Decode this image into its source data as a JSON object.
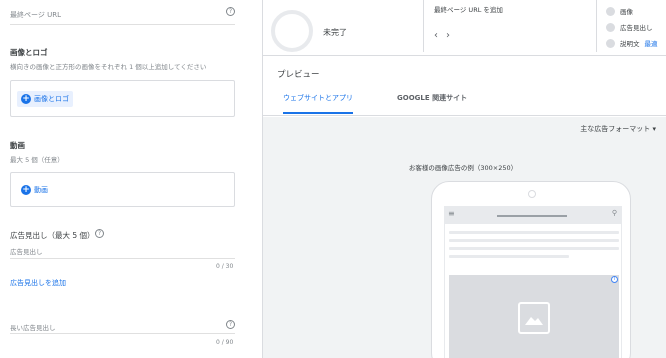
{
  "form": {
    "final_url_placeholder": "最終ページ URL",
    "images": {
      "label": "画像とロゴ",
      "sub": "横向きの画像と正方形の画像をそれぞれ 1 個以上追加してください",
      "button": "画像とロゴ"
    },
    "videos": {
      "label": "動画",
      "sub": "最大 5 個（任意）",
      "button": "動画"
    },
    "headlines": {
      "label": "広告見出し（最大 5 個）",
      "placeholder": "広告見出し",
      "counter": "0 / 30",
      "add_link": "広告見出しを追加"
    },
    "long_headline": {
      "placeholder": "長い広告見出し",
      "counter": "0 / 90"
    }
  },
  "status": {
    "progress_label": "未完了",
    "add_url_text": "最終ページ URL を追加",
    "checklist": [
      {
        "label": "画像"
      },
      {
        "label": "広告見出し"
      },
      {
        "label": "説明文",
        "extra": "最適"
      }
    ]
  },
  "preview": {
    "title": "プレビュー",
    "tabs": [
      "ウェブサイトとアプリ",
      "GOOGLE 関連サイト"
    ],
    "format_dropdown": "主な広告フォーマット",
    "caption": "お客様の画像広告の例（300×250）"
  },
  "icons": {
    "help": "help-circle-icon",
    "add": "plus-circle-icon",
    "image": "image-placeholder-icon",
    "menu": "hamburger-menu-icon",
    "search": "search-icon",
    "adchoices": "ad-choices-icon"
  },
  "colors": {
    "accent": "#1a73e8",
    "divider": "#dadce0",
    "preview_bg": "#f1f3f4"
  }
}
